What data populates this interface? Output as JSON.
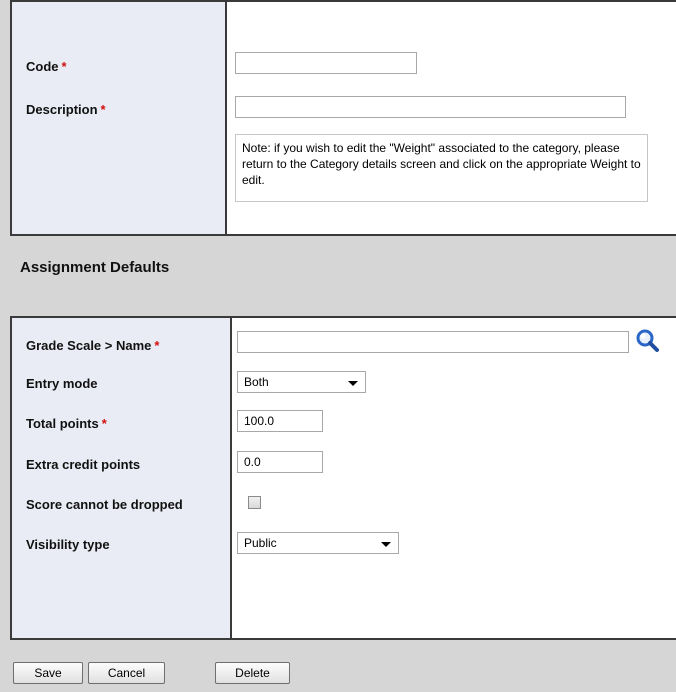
{
  "form": {
    "code_label": "Code",
    "code_value": "",
    "description_label": "Description",
    "description_value": "",
    "required_marker": "*",
    "note": "Note: if you wish to edit the \"Weight\" associated to the category, please return to the Category details screen and click on the appropriate Weight to edit."
  },
  "assignment_defaults": {
    "title": "Assignment Defaults",
    "grade_scale_label": "Grade Scale > Name",
    "grade_scale_value": "",
    "entry_mode_label": "Entry mode",
    "entry_mode_value": "Both",
    "total_points_label": "Total points",
    "total_points_value": "100.0",
    "extra_credit_label": "Extra credit points",
    "extra_credit_value": "0.0",
    "score_dropped_label": "Score cannot be dropped",
    "score_dropped_checked": false,
    "visibility_label": "Visibility type",
    "visibility_value": "Public"
  },
  "buttons": {
    "save": "Save",
    "cancel": "Cancel",
    "delete": "Delete"
  },
  "icons": {
    "lookup": "search-icon"
  },
  "colors": {
    "label_column_bg": "#eaecf5",
    "section_bg": "#d6d6d6",
    "required": "#d01010",
    "lookup_icon": "#2a66c8"
  }
}
